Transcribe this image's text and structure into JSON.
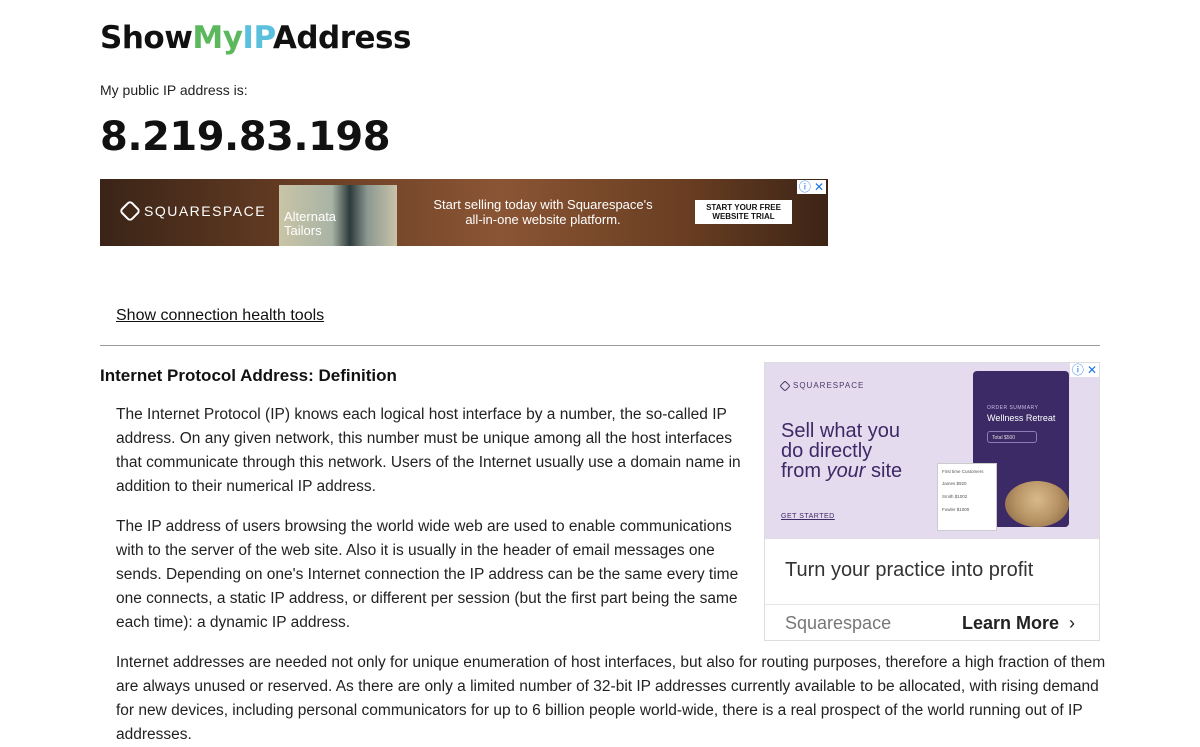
{
  "header": {
    "logo_part1": "Show",
    "logo_part2": "My",
    "logo_part3": "IP",
    "logo_part4": "Address",
    "ip_label": "My public IP address is:",
    "ip_value": "8.219.83.198"
  },
  "banner_ad": {
    "brand": "SQUARESPACE",
    "thumb_text_line1": "Alternata",
    "thumb_text_line2": "Tailors",
    "headline_line1": "Start selling today with Squarespace's",
    "headline_line2": "all-in-one website platform.",
    "cta_line1": "START YOUR FREE",
    "cta_line2": "WEBSITE TRIAL",
    "info_glyph": "ⓘ",
    "close_glyph": "✕"
  },
  "links": {
    "health_tools": "Show connection health tools"
  },
  "article": {
    "title": "Internet Protocol Address: Definition",
    "p1": "The Internet Protocol (IP) knows each logical host interface by a number, the so-called IP address. On any given network, this number must be unique among all the host interfaces that communicate through this network. Users of the Internet usually use a domain name in addition to their numerical IP address.",
    "p2": "The IP address of users browsing the world wide web are used to enable communications with to the server of the web site. Also it is usually in the header of email messages one sends. Depending on one's Internet connection the IP address can be the same every time one connects, a static IP address, or different per session (but the first part being the same each time): a dynamic IP address.",
    "p3": "Internet addresses are needed not only for unique enumeration of host interfaces, but also for routing purposes, therefore a high fraction of them are always unused or reserved. As there are only a limited number of 32-bit IP addresses currently available to be allocated, with rising demand for new devices, including personal communicators for up to 6 billion people world-wide, there is a real prospect of the world running out of IP addresses."
  },
  "side_ad": {
    "brand": "SQUARESPACE",
    "headline_line1": "Sell what you",
    "headline_line2": "do directly",
    "headline_line3a": "from ",
    "headline_line3b": "your",
    "headline_line3c": " site",
    "get_started": "GET STARTED",
    "phone_small": "ORDER SUMMARY",
    "phone_title": "Wellness Retreat",
    "phone_chip": "Total    $500",
    "table_title": "First time Customers",
    "table_rows": [
      "James    $920",
      "Smith    $1002",
      "Fowler   $1000"
    ],
    "caption": "Turn your practice into profit",
    "advertiser": "Squarespace",
    "learn_more": "Learn More",
    "chevron": "›",
    "info_glyph": "ⓘ",
    "close_glyph": "✕"
  },
  "colors": {
    "logo_my": "#5cb85c",
    "logo_ip": "#5bc0de",
    "ad_purple": "#3b2a66"
  }
}
